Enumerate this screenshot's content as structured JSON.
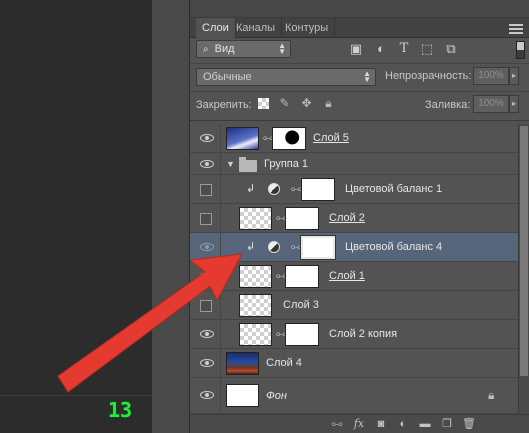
{
  "canvas": {
    "frame_counter": "13"
  },
  "panel": {
    "tabs": [
      {
        "label": "Слои",
        "active": true
      },
      {
        "label": "Каналы",
        "active": false
      },
      {
        "label": "Контуры",
        "active": false
      }
    ],
    "filter": {
      "label": "Вид",
      "icon": "search-icon"
    },
    "filter_icons": [
      "image-filter-icon",
      "adjustment-filter-icon",
      "type-filter-icon",
      "shape-filter-icon",
      "smart-object-filter-icon"
    ],
    "blend_mode": "Обычные",
    "opacity_label": "Непрозрачность:",
    "opacity_value": "100%",
    "lock_label": "Закрепить:",
    "lock_icons": [
      "lock-transparent-icon",
      "lock-pixels-icon",
      "lock-position-icon",
      "lock-all-icon"
    ],
    "fill_label": "Заливка:",
    "fill_value": "100%"
  },
  "layers": [
    {
      "name": "Слой 5",
      "visible": true,
      "kind": "image-mask",
      "underline": true
    },
    {
      "name": "Группа 1",
      "visible": true,
      "kind": "group"
    },
    {
      "name": "Цветовой баланс 1",
      "visible": false,
      "kind": "adjustment",
      "clipped": true
    },
    {
      "name": "Слой 2",
      "visible": false,
      "kind": "checker-mask",
      "underline": true
    },
    {
      "name": "Цветовой баланс 4",
      "visible": true,
      "kind": "adjustment",
      "clipped": true,
      "selected": true
    },
    {
      "name": "Слой 1",
      "visible": true,
      "kind": "checker-mask",
      "underline": true
    },
    {
      "name": "Слой 3",
      "visible": false,
      "kind": "checker"
    },
    {
      "name": "Слой 2 копия",
      "visible": true,
      "kind": "checker-mask"
    },
    {
      "name": "Слой 4",
      "visible": true,
      "kind": "image"
    },
    {
      "name": "Фон",
      "visible": true,
      "kind": "background",
      "italic": true,
      "locked": true
    }
  ],
  "bottom_icons": [
    "link-layers-icon",
    "fx-icon",
    "add-mask-icon",
    "new-adjustment-icon",
    "new-group-icon",
    "new-layer-icon",
    "delete-layer-icon"
  ],
  "colors": {
    "annotation_arrow": "#e53a2f",
    "selected_layer": "#56657a",
    "frame_counter": "#1cf03a"
  }
}
